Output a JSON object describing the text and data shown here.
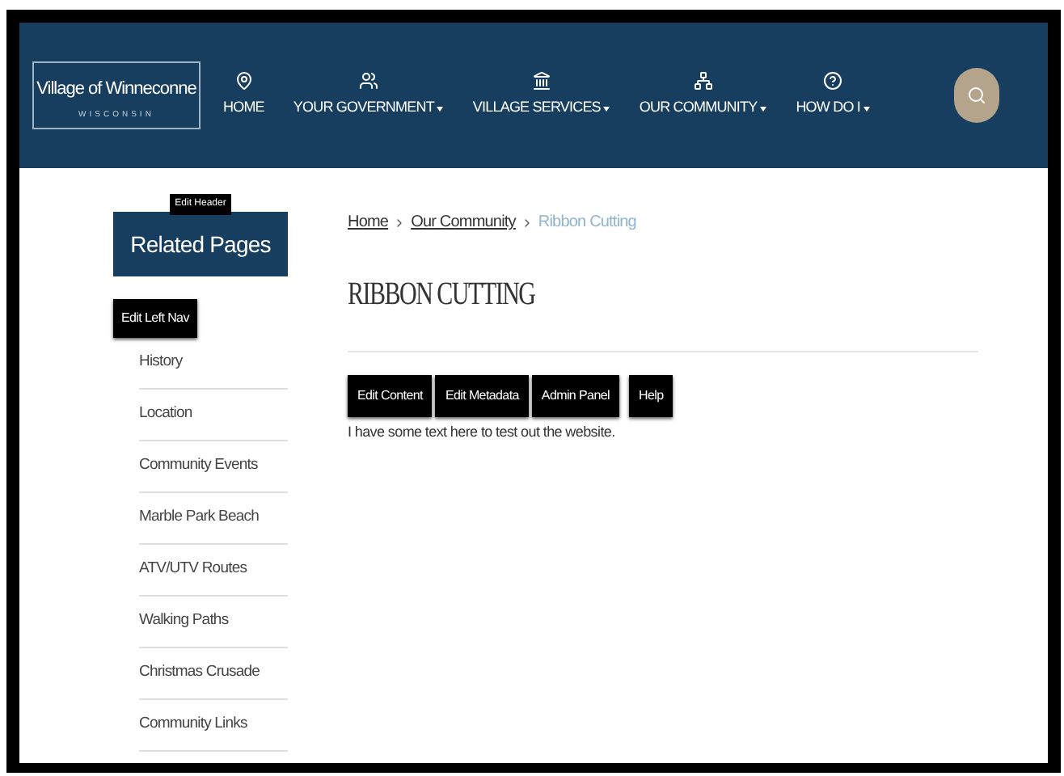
{
  "header": {
    "logo": {
      "title": "Village of Winneconne",
      "subtitle": "WISCONSIN"
    },
    "nav": [
      {
        "label": "HOME",
        "dropdown": false
      },
      {
        "label": "YOUR GOVERNMENT",
        "dropdown": true
      },
      {
        "label": "VILLAGE SERVICES",
        "dropdown": true
      },
      {
        "label": "OUR COMMUNITY",
        "dropdown": true
      },
      {
        "label": "HOW DO I",
        "dropdown": true
      }
    ],
    "search": {
      "kind": "search"
    }
  },
  "sidebar": {
    "edit_header": "Edit Header",
    "title": "Related Pages",
    "edit_nav": "Edit Left Nav",
    "items": [
      "History",
      "Location",
      "Community Events",
      "Marble Park Beach",
      "ATV/UTV Routes",
      "Walking Paths",
      "Christmas Crusade",
      "Community Links"
    ]
  },
  "breadcrumb": [
    {
      "label": "Home",
      "current": false
    },
    {
      "label": "Our Community",
      "current": false
    },
    {
      "label": "Ribbon Cutting",
      "current": true
    }
  ],
  "page_title": "RIBBON CUTTING",
  "admin_buttons": [
    "Edit Content",
    "Edit Metadata",
    "Admin Panel",
    "Help"
  ],
  "body_text": "I have some text here to test out the website."
}
